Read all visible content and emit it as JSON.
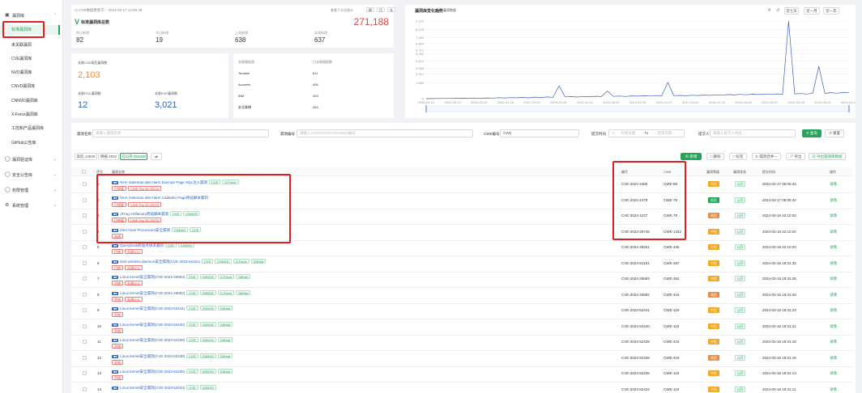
{
  "sidebar": {
    "groups": [
      {
        "label": "漏洞库",
        "icon": "database-icon"
      },
      {
        "label": "漏洞验证库",
        "icon": "shield-check-icon"
      },
      {
        "label": "安全公告库",
        "icon": "bell-icon"
      },
      {
        "label": "权限管理",
        "icon": "lock-icon"
      },
      {
        "label": "系统管理",
        "icon": "gear-icon"
      }
    ],
    "items": [
      "标准漏洞库",
      "未关联漏洞",
      "CVE漏洞库",
      "NVD漏洞库",
      "CNVD漏洞库",
      "CNNVD漏洞库",
      "X-Force漏洞库",
      "工控和产品漏洞库",
      "GitHub公告库"
    ]
  },
  "overview": {
    "update_time": "CVE数据更新于：2024-03-17 13:00:38",
    "view_label": "查看下方次统计",
    "total_label": "标准漏洞库总数",
    "total_value": "271,188",
    "stats": [
      {
        "label": "昨日新增",
        "value": "82"
      },
      {
        "label": "今日新增",
        "value": "19"
      },
      {
        "label": "上周新增",
        "value": "638"
      },
      {
        "label": "本周新增",
        "value": "637"
      }
    ],
    "toggles": [
      "周",
      "月",
      "年"
    ]
  },
  "middle": {
    "cve_label": "关联CVE高危漏洞数",
    "cve_value": "2,103",
    "poc_label": "关联POC漏洞数",
    "poc_value": "12",
    "exp_label": "关联EXP漏洞数",
    "exp_value": "3,021",
    "vendor_header": "关联情报源",
    "count_header": "已关联情报数",
    "vendors": [
      {
        "name": "Tenable",
        "count": "811"
      },
      {
        "name": "Acunetix",
        "count": "406"
      },
      {
        "name": "IBM",
        "count": "404"
      },
      {
        "name": "安全脉搏",
        "count": "354"
      }
    ]
  },
  "chart_panel": {
    "title": "漏洞库变化趋势",
    "legend": "漏洞数据",
    "buttons": [
      "近七天",
      "近一月",
      "近一年"
    ]
  },
  "chart_data": {
    "type": "line",
    "x_start": "1969-01-01",
    "x_end": "2024-03-17",
    "tick_labels": [
      "1969-01-01",
      "2002-09-13",
      "2004-06-22",
      "2006-01-28",
      "2007-09-29",
      "2009-05-26",
      "2010-12-22",
      "2012-08-22",
      "2014-03-29",
      "2015-11-07",
      "2017-05-20",
      "2018-12-22",
      "2020-03-06",
      "2021-06-07",
      "2022-03-05",
      "2023-06-01",
      "2024-01-17"
    ],
    "y_ticks": [
      0,
      1856,
      2912,
      3568,
      4424,
      5280,
      5712,
      6464,
      7168,
      8128,
      9120
    ],
    "ylim": [
      0,
      9120
    ],
    "series": [
      {
        "name": "漏洞数据",
        "values": [
          0,
          12,
          18,
          25,
          30,
          40,
          60,
          35,
          80,
          50,
          90,
          70,
          110,
          85,
          120,
          100,
          150,
          95,
          180,
          130,
          200,
          160,
          1500,
          210,
          240,
          190,
          260,
          230,
          280,
          250,
          900,
          270,
          300,
          260,
          320,
          290,
          340,
          310,
          360,
          330,
          1900,
          350,
          380,
          340,
          400,
          370,
          420,
          390,
          450,
          410,
          480,
          440,
          500,
          460,
          520,
          480,
          540,
          500,
          560,
          520,
          9120,
          560,
          600,
          540,
          650,
          3800,
          620,
          700,
          640,
          720,
          680
        ]
      }
    ],
    "grid": true
  },
  "filters": {
    "name_label": "漏洞名称",
    "name_placeholder": "请输入漏洞名称",
    "id_label": "漏洞编号",
    "id_placeholder": "请输入CVE/CNVD/CNNVD/ID编号",
    "cwe_label": "CWE编号",
    "cwe_value": "CWE",
    "date_label": "提交时间",
    "date_start": "开始日期",
    "date_to": "To",
    "date_end": "结束日期",
    "person_label": "提交人",
    "person_placeholder": "请输入提交人姓名",
    "search_btn": "查询",
    "reset_btn": "重置"
  },
  "tabs": [
    "高危 13020",
    "情报 2822",
    "已公开 254248"
  ],
  "actions": [
    "新增",
    "删除",
    "标签",
    "漏洞合并一",
    "导出",
    "导出漏洞库数据"
  ],
  "table": {
    "headers": [
      "序号",
      "漏洞名称",
      "编号",
      "CWE",
      "漏洞等级",
      "漏洞状态",
      "提交时间",
      "操作"
    ],
    "rows": [
      {
        "idx": "1",
        "name": "NHA Sistemas aiM Alarm Execute Page SQL注入漏洞",
        "sources": [
          "CVE",
          "X-Force"
        ],
        "redtags": [
          "已修复",
          "CWE Top 25 (2023)"
        ],
        "id": "CVE-2024-2480",
        "cwe": "CWE-89",
        "sev": "中危",
        "sevColor": "#f5a623",
        "status": "公开",
        "time": "2024-03-17 06:05:34",
        "op": "详情"
      },
      {
        "idx": "2",
        "name": "NHA Sistemas aiM Alarm Cadastro Page跨站脚本漏洞",
        "sources": [],
        "redtags": [
          "已修复",
          "CWE Top 25 (2023)"
        ],
        "id": "CVE-2024-2479",
        "cwe": "CWE-79",
        "sev": "低危",
        "sevColor": "#27a35a",
        "status": "公开",
        "time": "2024-03-17 06:05:32",
        "op": "详情"
      },
      {
        "idx": "3",
        "name": "JFrog Artifactory跨站脚本漏洞",
        "sources": [
          "CVE",
          "CNNVD"
        ],
        "redtags": [
          "已修复",
          "CWE Top 25 (2023)"
        ],
        "id": "CVE-2024-2247",
        "cwe": "CWE-79",
        "sev": "高危",
        "sevColor": "#ef8b3a",
        "status": "公开",
        "time": "2024-03-16 22:10:20",
        "op": "详情"
      },
      {
        "idx": "4",
        "name": "Intel Atom Processors安全漏洞",
        "sources": [
          "CNNVD",
          "CVE"
        ],
        "redtags": [
          "未修"
        ],
        "id": "CVE-2023-28746",
        "cwe": "CWE-1342",
        "sev": "中危",
        "sevColor": "#f5a623",
        "status": "公开",
        "time": "2024-03-16 22:10:20",
        "op": "详情"
      },
      {
        "idx": "5",
        "name": "Querybook跨站点请求漏洞",
        "sources": [
          "CVE",
          "CNNVD"
        ],
        "redtags": [
          "已修",
          "无调公公"
        ],
        "id": "CVE-2024-28251",
        "cwe": "CWE-345",
        "sev": "中危",
        "sevColor": "#f5a623",
        "status": "公开",
        "time": "2024-03-16 22:10:20",
        "op": "详情"
      },
      {
        "idx": "6",
        "name": "iNet wireless daemon安全漏洞(CVE-2023-52161)",
        "sources": [
          "CVE",
          "CNNVD",
          "X-Force",
          "GitHub"
        ],
        "redtags": [
          "已修",
          "无调公公"
        ],
        "id": "CVE-2023-52161",
        "cwe": "CWE-287",
        "sev": "中危",
        "sevColor": "#f5a623",
        "status": "公开",
        "time": "2024-03-16 19:31:32",
        "op": "详情"
      },
      {
        "idx": "7",
        "name": "Linux kernel安全漏洞(CVE-2024-26583)",
        "sources": [
          "CVE",
          "CNNVD",
          "X-Force",
          "GitHub"
        ],
        "redtags": [
          "不修",
          "无调公公"
        ],
        "id": "CVE-2024-26583",
        "cwe": "CWE-362",
        "sev": "中危",
        "sevColor": "#f5a623",
        "status": "公开",
        "time": "2024-03-16 19:31:28",
        "op": "详情"
      },
      {
        "idx": "8",
        "name": "Linux kernel安全漏洞(CVE-2024-26582)",
        "sources": [
          "CVE",
          "CNNVD",
          "X-Force",
          "GitHub"
        ],
        "redtags": [
          "不修",
          "无调公公"
        ],
        "id": "CVE-2024-26582",
        "cwe": "CWE-416",
        "sev": "高危",
        "sevColor": "#ef8b3a",
        "status": "公开",
        "time": "2024-03-16 19:31:26",
        "op": "详情"
      },
      {
        "idx": "9",
        "name": "Linux kernel安全漏洞(CVE-2023-52441)",
        "sources": [
          "CVE",
          "CNNVD",
          "GitHub"
        ],
        "redtags": [
          "不修"
        ],
        "id": "CVE-2023-52441",
        "cwe": "CWE-119",
        "sev": "中危",
        "sevColor": "#f5a623",
        "status": "公开",
        "time": "2024-03-16 19:31:23",
        "op": "详情"
      },
      {
        "idx": "10",
        "name": "Linux kernel安全漏洞(CVE-2023-52440)",
        "sources": [
          "CVE",
          "CNNVD",
          "GitHub"
        ],
        "redtags": [
          "不修"
        ],
        "id": "CVE-2023-52440",
        "cwe": "CWE-119",
        "sev": "中危",
        "sevColor": "#f5a623",
        "status": "公开",
        "time": "2024-03-16 19:31:21",
        "op": "详情"
      },
      {
        "idx": "11",
        "name": "Linux kernel安全漏洞(CVE-2023-52439)",
        "sources": [
          "CVE",
          "CNNVD",
          "GitHub"
        ],
        "redtags": [
          "不修"
        ],
        "id": "CVE-2023-52439",
        "cwe": "CWE-415",
        "sev": "中危",
        "sevColor": "#f5a623",
        "status": "公开",
        "time": "2024-03-16 19:31:18",
        "op": "详情"
      },
      {
        "idx": "12",
        "name": "Linux kernel安全漏洞(CVE-2023-52438)",
        "sources": [
          "CVE",
          "CNNVD",
          "GitHub"
        ],
        "redtags": [
          "不修"
        ],
        "id": "CVE-2023-52438",
        "cwe": "CWE-416",
        "sev": "高危",
        "sevColor": "#ef8b3a",
        "status": "公开",
        "time": "2024-03-16 19:31:16",
        "op": "详情"
      },
      {
        "idx": "13",
        "name": "Linux kernel安全漏洞(CVE-2023-52435)",
        "sources": [
          "CVE",
          "CNNVD",
          "GitHub"
        ],
        "redtags": [
          "不修"
        ],
        "id": "CVE-2023-52435",
        "cwe": "CWE-119",
        "sev": "中危",
        "sevColor": "#f5a623",
        "status": "公开",
        "time": "2024-03-16 19:31:13",
        "op": "详情"
      },
      {
        "idx": "14",
        "name": "Linux kernel安全漏洞(CVE-2023-52434)",
        "sources": [
          "CVE",
          "CNNVD"
        ],
        "redtags": [],
        "id": "CVE-2023-52434",
        "cwe": "CWE-119",
        "sev": "中危",
        "sevColor": "#f5a623",
        "status": "公开",
        "time": "2024-03-16 19:31:11",
        "op": "详情"
      }
    ]
  },
  "colors": {
    "accent": "#27a35a",
    "danger": "#e02020",
    "chart": "#3f5fbf"
  }
}
